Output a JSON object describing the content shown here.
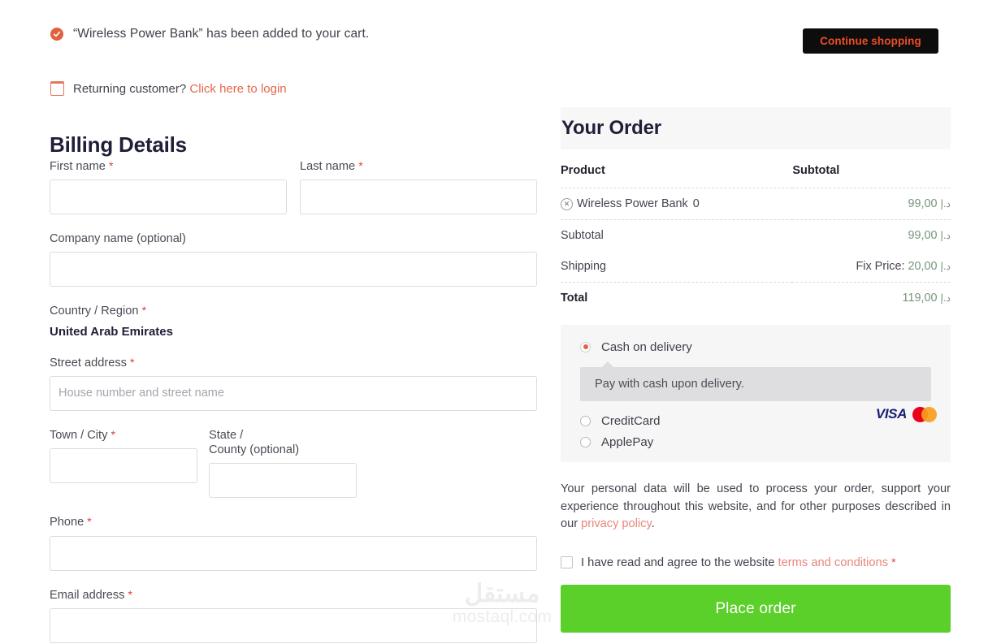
{
  "notice": {
    "icon": "check-circle-icon",
    "message": "“Wireless Power Bank” has been added to your cart.",
    "continue_label": "Continue shopping",
    "continue_bg": "#0d0d0d",
    "continue_color": "#ef4d28"
  },
  "returning": {
    "icon": "login-box-icon",
    "text": "Returning customer?",
    "link": "Click here to login"
  },
  "billing": {
    "title": "Billing Details",
    "required_mark": "*",
    "fields": {
      "first_name": {
        "label": "First name",
        "value": "",
        "placeholder": ""
      },
      "last_name": {
        "label": "Last name",
        "value": "",
        "placeholder": ""
      },
      "company": {
        "label": "Company name (optional)",
        "value": "",
        "placeholder": ""
      },
      "country": {
        "label": "Country / Region",
        "value": "United Arab Emirates"
      },
      "street": {
        "label": "Street address",
        "value": "",
        "placeholder": "House number and street name"
      },
      "city": {
        "label": "Town / City",
        "value": "",
        "placeholder": ""
      },
      "state": {
        "label": "State /",
        "label2": "County (optional)",
        "value": "",
        "placeholder": ""
      },
      "phone": {
        "label": "Phone",
        "value": "",
        "placeholder": ""
      },
      "email": {
        "label": "Email address",
        "value": "",
        "placeholder": ""
      }
    }
  },
  "order": {
    "title": "Your Order",
    "columns": {
      "product": "Product",
      "subtotal": "Subtotal"
    },
    "currency": "د.إ",
    "items": [
      {
        "remove_icon": "remove-item-icon",
        "name": "Wireless Power Bank",
        "qty": "0",
        "amount": "99,00"
      }
    ],
    "subtotal": {
      "label": "Subtotal",
      "amount": "99,00"
    },
    "shipping": {
      "label": "Shipping",
      "prefix": "Fix Price:",
      "amount": "20,00"
    },
    "total": {
      "label": "Total",
      "amount": "119,00"
    }
  },
  "payment": {
    "options": [
      {
        "label": "Cash on delivery",
        "selected": true
      },
      {
        "label": "CreditCard",
        "selected": false
      },
      {
        "label": "ApplePay",
        "selected": false
      }
    ],
    "description": "Pay with cash upon delivery.",
    "cards": {
      "visa": "VISA",
      "mastercard_icon": "mastercard-icon"
    },
    "accent_color": "#e2603f"
  },
  "privacy": {
    "text_before": "Your personal data will be used to process your order, support your experience throughout this website, and for other purposes described in our ",
    "link": "privacy policy",
    "text_after": "."
  },
  "terms": {
    "text_before": "I have read and agree to the website ",
    "link": "terms and conditions",
    "required_mark": "*",
    "checked": false
  },
  "place_order": {
    "label": "Place order",
    "bg": "#5bcf2a"
  },
  "watermark": {
    "arabic": "مستقل",
    "latin": "mostaql.com"
  }
}
